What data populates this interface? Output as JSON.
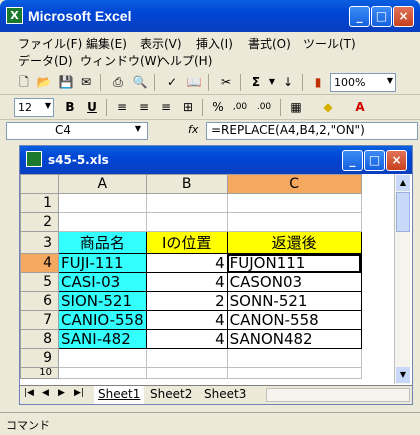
{
  "window": {
    "title": "Microsoft Excel",
    "min": "_",
    "max": "□",
    "close": "×"
  },
  "menus": [
    {
      "label": "ファイル(F)"
    },
    {
      "label": "編集(E)"
    },
    {
      "label": "表示(V)"
    },
    {
      "label": "挿入(I)"
    },
    {
      "label": "書式(O)"
    },
    {
      "label": "ツール(T)"
    },
    {
      "label": "データ(D)"
    },
    {
      "label": "ウィンドウ(W)"
    },
    {
      "label": "ヘルプ(H)"
    }
  ],
  "toolbar": {
    "zoom": "100%",
    "fontsize": "12",
    "sigma": "Σ"
  },
  "formula": {
    "cell": "C4",
    "fx": "fx",
    "content": "=REPLACE(A4,B4,2,\"ON\")"
  },
  "doc": {
    "title": "s45-5.xls"
  },
  "columns": [
    "A",
    "B",
    "C"
  ],
  "rows": [
    {
      "n": "1",
      "a": "",
      "b": "",
      "c": ""
    },
    {
      "n": "2",
      "a": "",
      "b": "",
      "c": ""
    },
    {
      "n": "3",
      "a": "商品名",
      "b": "Iの位置",
      "c": "返還後"
    },
    {
      "n": "4",
      "a": "FUJI-111",
      "b": "4",
      "c": "FUJON111"
    },
    {
      "n": "5",
      "a": "CASI-03",
      "b": "4",
      "c": "CASON03"
    },
    {
      "n": "6",
      "a": "SION-521",
      "b": "2",
      "c": "SONN-521"
    },
    {
      "n": "7",
      "a": "CANIO-558",
      "b": "4",
      "c": "CANON-558"
    },
    {
      "n": "8",
      "a": "SANI-482",
      "b": "4",
      "c": "SANON482"
    },
    {
      "n": "9",
      "a": "",
      "b": "",
      "c": ""
    },
    {
      "n": "10",
      "a": "",
      "b": "",
      "c": ""
    }
  ],
  "sheets": [
    "Sheet1",
    "Sheet2",
    "Sheet3"
  ],
  "status": "コマンド"
}
